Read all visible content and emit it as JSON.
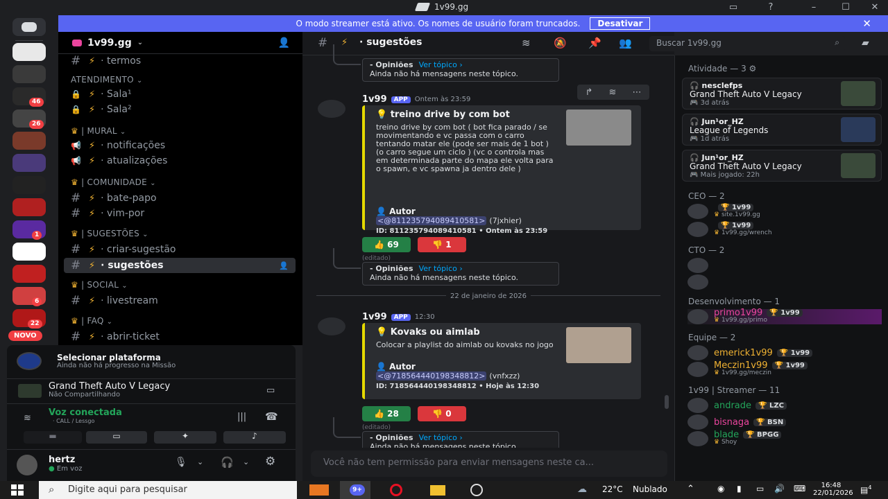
{
  "window": {
    "title": "1v99.gg"
  },
  "banner": {
    "text": "O modo streamer está ativo. Os nomes de usuário foram truncados.",
    "button": "Desativar"
  },
  "guild_badges": [
    "46",
    "26",
    "1",
    "6",
    "22",
    "NOVO"
  ],
  "server": {
    "name": "1v99.gg"
  },
  "channels": {
    "items": [
      {
        "type": "channel",
        "name": "termos",
        "icon": "hash"
      },
      {
        "type": "category",
        "name": "ATENDIMENTO"
      },
      {
        "type": "channel",
        "name": "Sala¹",
        "icon": "lock"
      },
      {
        "type": "channel",
        "name": "Sala²",
        "icon": "lock"
      },
      {
        "type": "category",
        "name": "| MURAL"
      },
      {
        "type": "channel",
        "name": "notificações",
        "icon": "megaphone"
      },
      {
        "type": "channel",
        "name": "atualizações",
        "icon": "megaphone"
      },
      {
        "type": "category",
        "name": "| COMUNIDADE"
      },
      {
        "type": "channel",
        "name": "bate-papo",
        "icon": "hash"
      },
      {
        "type": "channel",
        "name": "vim-por",
        "icon": "hash"
      },
      {
        "type": "category",
        "name": "| SUGESTÕES"
      },
      {
        "type": "channel",
        "name": "criar-sugestão",
        "icon": "hash"
      },
      {
        "type": "channel",
        "name": "sugestões",
        "icon": "hash",
        "selected": true
      },
      {
        "type": "category",
        "name": "| SOCIAL"
      },
      {
        "type": "channel",
        "name": "livestream",
        "icon": "hash"
      },
      {
        "type": "category",
        "name": "| FAQ"
      },
      {
        "type": "channel",
        "name": "abrir-ticket",
        "icon": "hash"
      }
    ]
  },
  "panel": {
    "quest_title": "Selecionar plataforma",
    "quest_sub": "Ainda não há progresso na Missão",
    "game_title": "Grand Theft Auto V Legacy",
    "game_sub": "Não Compartilhando",
    "voice_status": "Voz conectada",
    "voice_sub": "CALL / Lessgo",
    "user_name": "hertz",
    "user_status": "Em voz"
  },
  "channel_header": {
    "name": "sugestões",
    "search_placeholder": "Buscar 1v99.gg"
  },
  "messages": [
    {
      "thread_label": "Opiniões",
      "thread_link": "Ver tópico ›",
      "thread_empty": "Ainda não há mensagens neste tópico."
    },
    {
      "author": "1v99",
      "app_tag": "APP",
      "time": "Ontem às 23:59",
      "embed_title": "treino drive by com bot",
      "embed_desc": "treino drive by com bot ( bot fica parado / se movimentando e vc passa com o carro tentando matar ele (pode ser mais de 1 bot ) (o carro segue um ciclo ) (vc o controla mas em determinada parte do mapa ele volta para o spawn, e vc spawna ja dentro dele )",
      "autor_label": "Autor",
      "mention": "<@811235794089410581>",
      "mention_user": "(7jxhier)",
      "footer": "ID: 811235794089410581 • Ontem às 23:59",
      "up": "69",
      "down": "1",
      "edited": "(editado)",
      "thread_label": "Opiniões",
      "thread_link": "Ver tópico ›",
      "thread_empty": "Ainda não há mensagens neste tópico."
    },
    {
      "divider": "22 de janeiro de 2026",
      "author": "1v99",
      "app_tag": "APP",
      "time": "12:30",
      "embed_title": "Kovaks ou aimlab",
      "embed_desc": "Colocar a playlist do aimlab ou kovaks no jogo",
      "autor_label": "Autor",
      "mention": "<@718564440198348812>",
      "mention_user": "(vnfxzz)",
      "footer": "ID: 718564440198348812 • Hoje às 12:30",
      "up": "28",
      "down": "0",
      "edited": "(editado)",
      "thread_label": "Opiniões",
      "thread_link": "Ver tópico ›",
      "thread_empty": "Ainda não há mensagens neste tópico."
    }
  ],
  "composer": {
    "placeholder": "Você não tem permissão para enviar mensagens neste ca..."
  },
  "members": {
    "activity_header": "Atividade — 3",
    "activities": [
      {
        "user": "nesclefps",
        "game": "Grand Theft Auto V Legacy",
        "time": "3d atrás"
      },
      {
        "user": "Jun¹or_HZ",
        "game": "League of Legends",
        "time": "1d atrás"
      },
      {
        "user": "Jun¹or_HZ",
        "game": "Grand Theft Auto V Legacy",
        "time": "Mais jogado: 22h"
      }
    ],
    "groups": [
      {
        "header": "CEO — 2",
        "rows": [
          {
            "name": "",
            "tag": "1v99",
            "sub": "site.1v99.gg"
          },
          {
            "name": "",
            "tag": "1v99",
            "sub": "1v99.gg/wrench"
          }
        ]
      },
      {
        "header": "CTO — 2",
        "rows": [
          {
            "name": "",
            "tag": "",
            "sub": ""
          },
          {
            "name": "",
            "tag": "",
            "sub": ""
          }
        ]
      },
      {
        "header": "Desenvolvimento — 1",
        "rows": [
          {
            "name": "primo1v99",
            "tag": "1v99",
            "sub": "1v99.gg/primo"
          }
        ]
      },
      {
        "header": "Equipe — 2",
        "rows": [
          {
            "name": "emerick1v99",
            "tag": "1v99",
            "sub": ""
          },
          {
            "name": "Meczin1v99",
            "tag": "1v99",
            "sub": "1v99.gg/meczin"
          }
        ]
      },
      {
        "header": "1v99 | Streamer — 11",
        "rows": [
          {
            "name": "andrade",
            "tag": "LZC",
            "sub": ""
          },
          {
            "name": "bisnaga",
            "tag": "BSN",
            "sub": ""
          },
          {
            "name": "blade",
            "tag": "BPGG",
            "sub": "Shoy"
          }
        ]
      }
    ]
  },
  "taskbar": {
    "search_placeholder": "Digite aqui para pesquisar",
    "weather_temp": "22°C",
    "weather_text": "Nublado",
    "time": "16:48",
    "date": "22/01/2026",
    "discord_badge": "9+",
    "notif_count": "4"
  }
}
